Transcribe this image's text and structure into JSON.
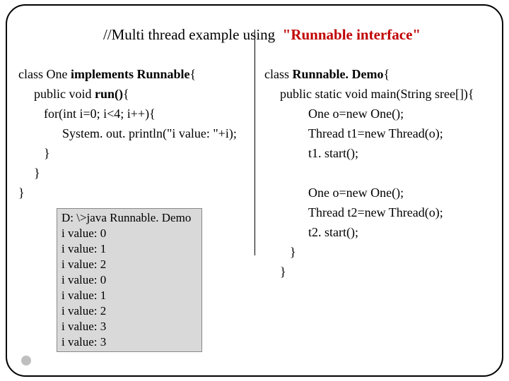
{
  "title": {
    "prefix": "//Multi thread example using  ",
    "highlight": "\"Runnable interface\""
  },
  "left": {
    "l1a": "class One ",
    "l1b": "implements Runnable",
    "l1c": "{",
    "l2a": "public void ",
    "l2b": "run()",
    "l2c": "{",
    "l3": "for(int i=0; i<4; i++){",
    "l4": "System. out. println(\"i value: \"+i);",
    "l5": "}",
    "l6": "}",
    "l7": "}"
  },
  "output": {
    "o1": "D: \\>java Runnable. Demo",
    "o2": "i value: 0",
    "o3": "i value: 1",
    "o4": "i value: 2",
    "o5": "i value: 0",
    "o6": "i value: 1",
    "o7": "i value: 2",
    "o8": "i value: 3",
    "o9": "i value: 3"
  },
  "right": {
    "r1a": "class ",
    "r1b": "Runnable. Demo",
    "r1c": "{",
    "r2": "public static void main(String sree[]){",
    "r3": "One o=new One();",
    "r4": "Thread t1=new Thread(o);",
    "r5": "t1. start();",
    "blank": " ",
    "r6": "One o=new One();",
    "r7": "Thread t2=new Thread(o);",
    "r8": "t2. start();",
    "r9": "}",
    "r10": "}"
  }
}
